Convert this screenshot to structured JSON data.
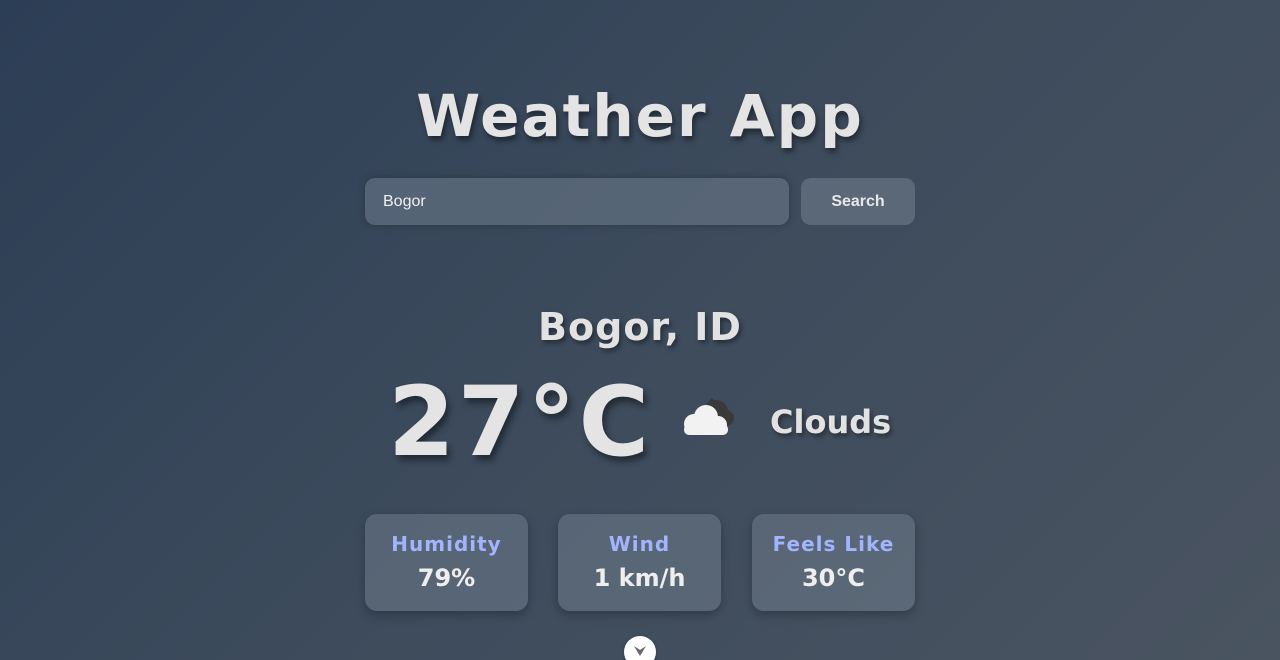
{
  "app": {
    "title": "Weather App"
  },
  "search": {
    "value": "Bogor",
    "placeholder": "",
    "button_label": "Search"
  },
  "weather": {
    "location": "Bogor, ID",
    "temperature": "27°C",
    "condition": "Clouds",
    "icon": "cloud-icon"
  },
  "stats": [
    {
      "label": "Humidity",
      "value": "79%"
    },
    {
      "label": "Wind",
      "value": "1 km/h"
    },
    {
      "label": "Feels Like",
      "value": "30°C"
    }
  ],
  "colors": {
    "stat_label": "#a3b4ff",
    "text": "#e4e4e4"
  }
}
